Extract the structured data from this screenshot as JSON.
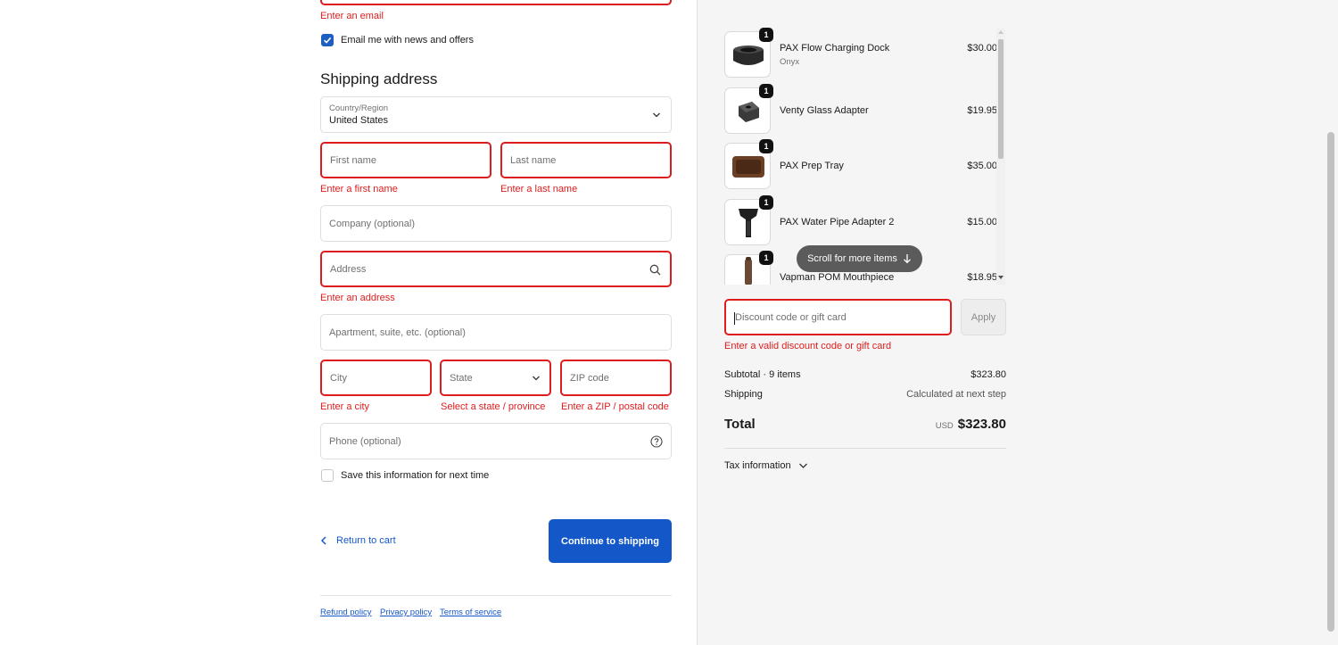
{
  "contact": {
    "email_error": "Enter an email",
    "marketing_label": "Email me with news and offers",
    "marketing_checked": true
  },
  "shipping": {
    "heading": "Shipping address",
    "country_label": "Country/Region",
    "country_value": "United States",
    "first_name_placeholder": "First name",
    "first_name_error": "Enter a first name",
    "last_name_placeholder": "Last name",
    "last_name_error": "Enter a last name",
    "company_placeholder": "Company (optional)",
    "address_placeholder": "Address",
    "address_error": "Enter an address",
    "apartment_placeholder": "Apartment, suite, etc. (optional)",
    "city_placeholder": "City",
    "city_error": "Enter a city",
    "state_placeholder": "State",
    "state_error": "Select a state / province",
    "zip_placeholder": "ZIP code",
    "zip_error": "Enter a ZIP / postal code",
    "phone_placeholder": "Phone (optional)",
    "save_info_label": "Save this information for next time",
    "save_info_checked": false
  },
  "actions": {
    "return_label": "Return to cart",
    "continue_label": "Continue to shipping"
  },
  "footer": {
    "refund": "Refund policy",
    "privacy": "Privacy policy",
    "terms": "Terms of service"
  },
  "cart": {
    "items": [
      {
        "name": "PAX Flow Charging Dock",
        "variant": "Onyx",
        "price": "$30.00",
        "qty": "1",
        "icon": "charging-dock"
      },
      {
        "name": "Venty Glass Adapter",
        "variant": "",
        "price": "$19.95",
        "qty": "1",
        "icon": "glass-adapter"
      },
      {
        "name": "PAX Prep Tray",
        "variant": "",
        "price": "$35.00",
        "qty": "1",
        "icon": "prep-tray"
      },
      {
        "name": "PAX Water Pipe Adapter 2",
        "variant": "",
        "price": "$15.00",
        "qty": "1",
        "icon": "water-pipe-adapter"
      },
      {
        "name": "Vapman POM Mouthpiece",
        "variant": "",
        "price": "$18.95",
        "qty": "1",
        "icon": "mouthpiece"
      }
    ],
    "scroll_hint": "Scroll for more items",
    "discount_placeholder": "Discount code or gift card",
    "discount_error": "Enter a valid discount code or gift card",
    "apply_label": "Apply"
  },
  "summary": {
    "subtotal_label": "Subtotal · 9 items",
    "subtotal_value": "$323.80",
    "shipping_label": "Shipping",
    "shipping_value": "Calculated at next step",
    "total_label": "Total",
    "currency": "USD",
    "total_value": "$323.80",
    "tax_label": "Tax information"
  },
  "colors": {
    "accent": "#1357c9",
    "error": "#dd1d1d"
  }
}
